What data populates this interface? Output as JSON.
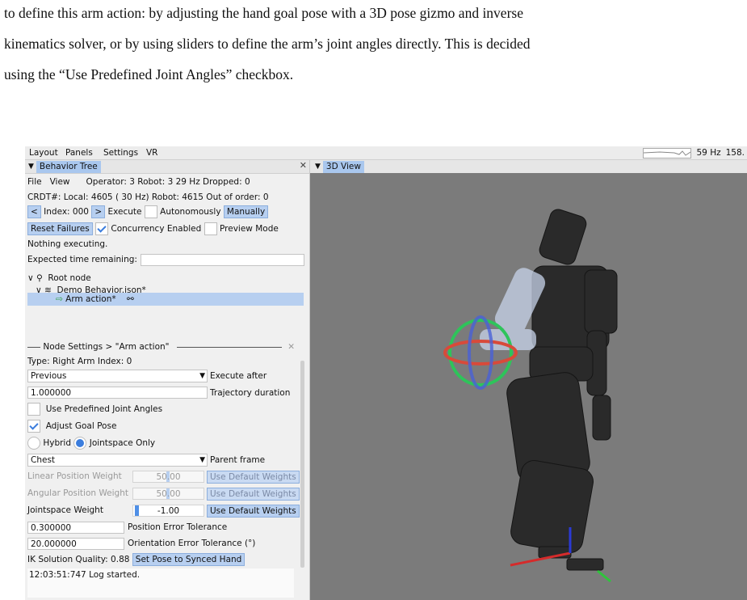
{
  "paper": {
    "line1": "to define this arm action: by adjusting the hand goal pose with a 3D pose gizmo and inverse",
    "line2": "kinematics solver, or by using sliders to define the arm’s joint angles directly. This is decided",
    "line3": "using the “Use Predefined Joint Angles” checkbox."
  },
  "menubar": {
    "items": [
      "Layout",
      "Panels",
      "Settings",
      "VR"
    ],
    "rate": "59 Hz",
    "rate2": "158."
  },
  "behavior_tree": {
    "tab_label": "Behavior Tree",
    "menu_file": "File",
    "menu_view": "View",
    "status": "Operator:  3 Robot:  3    29 Hz  Dropped:   0",
    "crdt": "CRDT#: Local: 4605 ( 30 Hz)  Robot: 4615  Out of order: 0",
    "prev": "<",
    "index": "Index: 000",
    "next": ">",
    "execute": "Execute",
    "autonomously": "Autonomously",
    "manually": "Manually",
    "reset": "Reset Failures",
    "concurrency": "Concurrency Enabled",
    "preview": "Preview Mode",
    "nothing": "Nothing executing.",
    "expected": "Expected time remaining:",
    "root": "Root node",
    "demo": "Demo Behavior.json*",
    "arm": "Arm action*"
  },
  "node_settings": {
    "header": "Node Settings > \"Arm action\"",
    "type": "Type: Right Arm   Index: 0",
    "execute_after_value": "Previous",
    "execute_after_label": "Execute after",
    "duration_value": "1.000000",
    "duration_label": "Trajectory duration",
    "predef": "Use Predefined Joint Angles",
    "adjust": "Adjust Goal Pose",
    "hybrid": "Hybrid",
    "jointspace": "Jointspace Only",
    "parent_value": "Chest",
    "parent_label": "Parent frame",
    "linear_label": "Linear Position Weight",
    "linear_value": "50.00",
    "angular_label": "Angular Position Weight",
    "angular_value": "50.00",
    "joint_label": "Jointspace Weight",
    "joint_value": "-1.00",
    "default_weights": "Use Default Weights",
    "pos_tol_value": "0.300000",
    "pos_tol_label": "Position Error Tolerance",
    "ori_tol_value": "20.000000",
    "ori_tol_label": "Orientation Error Tolerance (°)",
    "ik": "IK Solution Quality: 0.88",
    "set_pose": "Set Pose to Synced Hand",
    "log": "12:03:51:747 Log started."
  },
  "view3d": {
    "tab_label": "3D View"
  }
}
